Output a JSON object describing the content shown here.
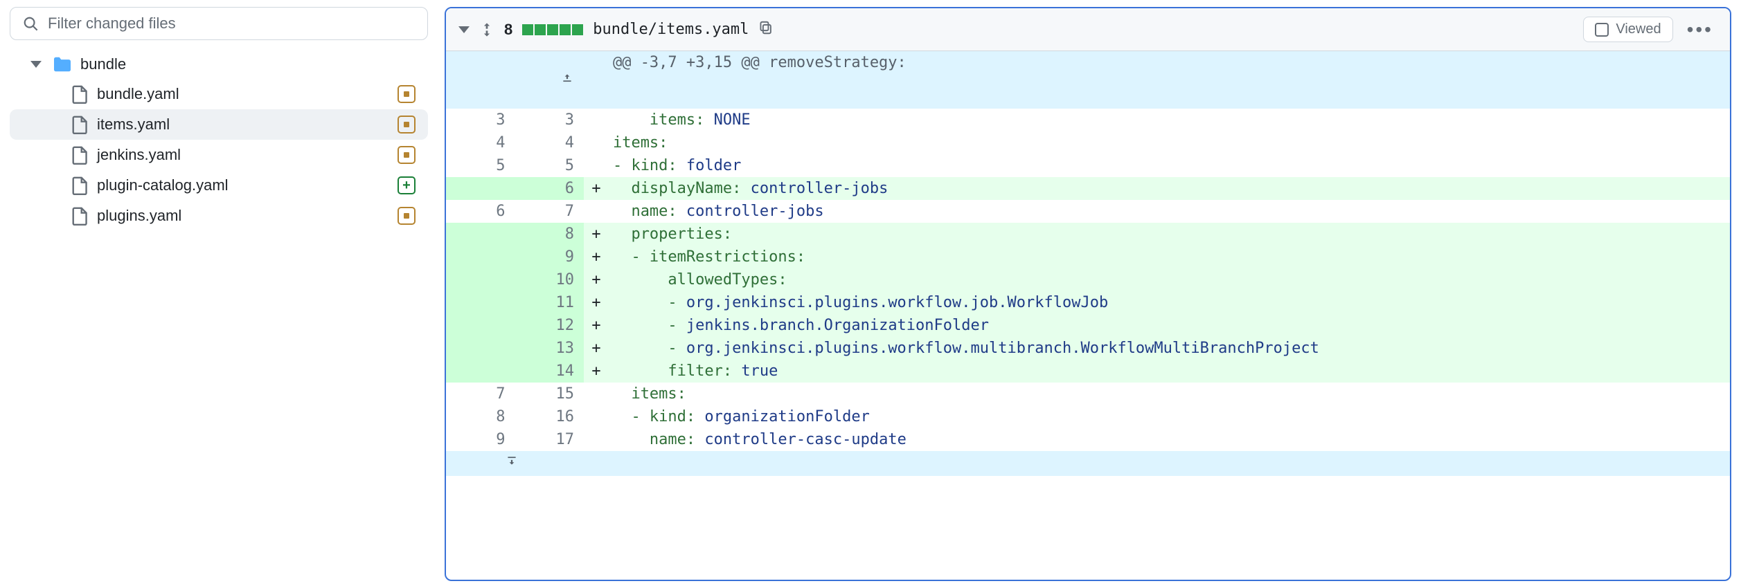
{
  "sidebar": {
    "filter_placeholder": "Filter changed files",
    "folder": {
      "name": "bundle"
    },
    "files": [
      {
        "name": "bundle.yaml",
        "status": "modified",
        "active": false
      },
      {
        "name": "items.yaml",
        "status": "modified",
        "active": true
      },
      {
        "name": "jenkins.yaml",
        "status": "modified",
        "active": false
      },
      {
        "name": "plugin-catalog.yaml",
        "status": "added",
        "active": false
      },
      {
        "name": "plugins.yaml",
        "status": "modified",
        "active": false
      }
    ]
  },
  "diff": {
    "change_count": "8",
    "file_path": "bundle/items.yaml",
    "viewed_label": "Viewed",
    "hunk_header": "@@ -3,7 +3,15 @@ removeStrategy:",
    "rows": [
      {
        "type": "ctx",
        "old": "3",
        "new": "3",
        "sign": " ",
        "indent": "    ",
        "key": "items:",
        "val": " NONE"
      },
      {
        "type": "ctx",
        "old": "4",
        "new": "4",
        "sign": " ",
        "indent": "",
        "key": "items:",
        "val": ""
      },
      {
        "type": "ctx",
        "old": "5",
        "new": "5",
        "sign": " ",
        "indent": "",
        "key": "- kind:",
        "val": " folder"
      },
      {
        "type": "add",
        "old": "",
        "new": "6",
        "sign": "+",
        "indent": "  ",
        "key": "displayName:",
        "val": " controller-jobs"
      },
      {
        "type": "ctx",
        "old": "6",
        "new": "7",
        "sign": " ",
        "indent": "  ",
        "key": "name:",
        "val": " controller-jobs"
      },
      {
        "type": "add",
        "old": "",
        "new": "8",
        "sign": "+",
        "indent": "  ",
        "key": "properties:",
        "val": ""
      },
      {
        "type": "add",
        "old": "",
        "new": "9",
        "sign": "+",
        "indent": "  ",
        "key": "- itemRestrictions:",
        "val": ""
      },
      {
        "type": "add",
        "old": "",
        "new": "10",
        "sign": "+",
        "indent": "      ",
        "key": "allowedTypes:",
        "val": ""
      },
      {
        "type": "add",
        "old": "",
        "new": "11",
        "sign": "+",
        "indent": "      ",
        "key": "- ",
        "val": "org.jenkinsci.plugins.workflow.job.WorkflowJob"
      },
      {
        "type": "add",
        "old": "",
        "new": "12",
        "sign": "+",
        "indent": "      ",
        "key": "- ",
        "val": "jenkins.branch.OrganizationFolder"
      },
      {
        "type": "add",
        "old": "",
        "new": "13",
        "sign": "+",
        "indent": "      ",
        "key": "- ",
        "val": "org.jenkinsci.plugins.workflow.multibranch.WorkflowMultiBranchProject"
      },
      {
        "type": "add",
        "old": "",
        "new": "14",
        "sign": "+",
        "indent": "      ",
        "key": "filter:",
        "val": " true",
        "bool": true
      },
      {
        "type": "ctx",
        "old": "7",
        "new": "15",
        "sign": " ",
        "indent": "  ",
        "key": "items:",
        "val": ""
      },
      {
        "type": "ctx",
        "old": "8",
        "new": "16",
        "sign": " ",
        "indent": "  ",
        "key": "- kind:",
        "val": " organizationFolder"
      },
      {
        "type": "ctx",
        "old": "9",
        "new": "17",
        "sign": " ",
        "indent": "    ",
        "key": "name:",
        "val": " controller-casc-update"
      }
    ]
  }
}
